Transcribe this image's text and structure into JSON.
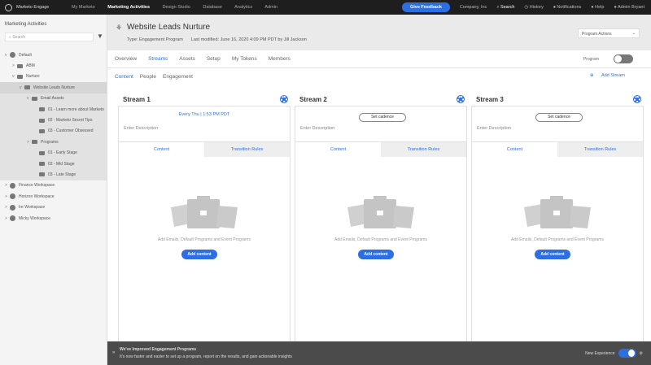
{
  "topbar": {
    "app": "Marketo Engage",
    "nav": [
      "My Marketo",
      "Marketing Activities",
      "Design Studio",
      "Database",
      "Analytics",
      "Admin"
    ],
    "active": "Marketing Activities",
    "feedback": "Give Feedback",
    "company": "Company, Inc",
    "search": "Search",
    "history": "History",
    "notifications": "Notifications",
    "help": "Help",
    "user": "Admin Bryant"
  },
  "sidebar": {
    "title": "Marketing Activities",
    "search_placeholder": "Search",
    "tree": [
      {
        "label": "Default",
        "level": 0,
        "caret": "v",
        "icon": "workspace"
      },
      {
        "label": "ABM",
        "level": 1,
        "caret": ">",
        "icon": "folder"
      },
      {
        "label": "Nurture",
        "level": 1,
        "caret": "v",
        "icon": "folder"
      },
      {
        "label": "Website Leads Nurture",
        "level": 2,
        "caret": "v",
        "icon": "engagement",
        "selected": true
      },
      {
        "label": "Email Assets",
        "level": 3,
        "caret": "v",
        "icon": "folder"
      },
      {
        "label": "01 - Learn more about Marketo",
        "level": 4,
        "icon": "email"
      },
      {
        "label": "02 - Marketo Secret Tips",
        "level": 4,
        "icon": "email"
      },
      {
        "label": "03 - Customer Obsessed",
        "level": 4,
        "icon": "email"
      },
      {
        "label": "Programs",
        "level": 3,
        "caret": ">",
        "icon": "folder"
      },
      {
        "label": "01 - Early Stage",
        "level": 4,
        "icon": "program"
      },
      {
        "label": "02 - Mid Stage",
        "level": 4,
        "icon": "program"
      },
      {
        "label": "03 - Late Stage",
        "level": 4,
        "icon": "program"
      },
      {
        "label": "Finance Workspace",
        "level": 0,
        "caret": ">",
        "icon": "workspace"
      },
      {
        "label": "Horizon Workspace",
        "level": 0,
        "caret": ">",
        "icon": "workspace"
      },
      {
        "label": "Ire Workspace",
        "level": 0,
        "caret": ">",
        "icon": "workspace"
      },
      {
        "label": "Micky Workspace",
        "level": 0,
        "caret": ">",
        "icon": "workspace"
      }
    ]
  },
  "header": {
    "title": "Website Leads Nurture",
    "type": "Type: Engagement Program",
    "modified": "Last modified: June 16, 2020 4:09 PM PDT by Jill Jackson",
    "actions": "Program Actions"
  },
  "tabs": [
    "Overview",
    "Streams",
    "Assets",
    "Setup",
    "My Tokens",
    "Members"
  ],
  "program_label": "Program",
  "program_on": false,
  "subtabs": [
    "Content",
    "People",
    "Engagement"
  ],
  "add_stream": "Add Stream",
  "streams": [
    {
      "title": "Stream 1",
      "cadence": "Every Thu | 1:53 PM PDT",
      "desc": "Enter Description",
      "tab_content": "Content",
      "tab_rules": "Transition Rules",
      "empty": "Add Emails, Default Programs and Event Programs",
      "add": "Add content"
    },
    {
      "title": "Stream 2",
      "cadence_btn": "Set cadence",
      "desc": "Enter Description",
      "tab_content": "Content",
      "tab_rules": "Transition Rules",
      "empty": "Add Emails, Default Programs and Event Programs",
      "add": "Add content"
    },
    {
      "title": "Stream 3",
      "cadence_btn": "Set cadence",
      "desc": "Enter Description",
      "tab_content": "Content",
      "tab_rules": "Transition Rules",
      "empty": "Add Emails, Default Programs and Event Programs",
      "add": "Add content"
    }
  ],
  "banner": {
    "title": "We've Improved Engagement Programs",
    "text": "It's now faster and easier to set up a program, report on the results, and gain actionable insights",
    "toggle_label": "New Experience",
    "toggle_on": true
  },
  "colors": {
    "accent": "#2d6fe0",
    "topbar": "#1e1e1e",
    "banner": "#4b4b4b"
  }
}
